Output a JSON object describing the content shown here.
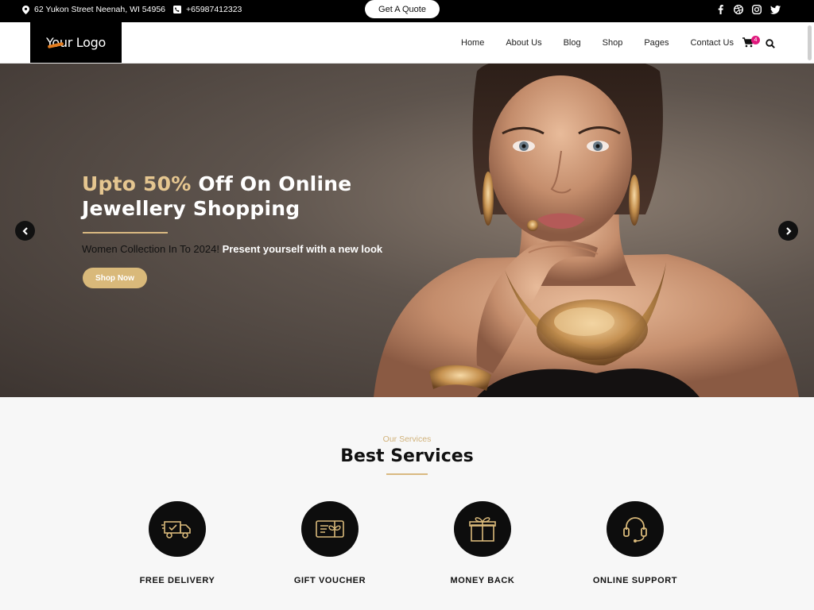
{
  "topbar": {
    "address": "62 Yukon Street Neenah, WI 54956",
    "phone": "+65987412323",
    "quote_label": "Get A Quote",
    "socials": [
      "facebook-icon",
      "dribbble-icon",
      "instagram-icon",
      "twitter-icon"
    ]
  },
  "nav": {
    "logo": "Your Logo",
    "menu": [
      "Home",
      "About Us",
      "Blog",
      "Shop",
      "Pages",
      "Contact Us"
    ],
    "cart_count": "4"
  },
  "hero": {
    "title_accent": "Upto 50%",
    "title_rest": " Off On Online",
    "title_line2": "Jewellery Shopping",
    "subtitle_dark": "Women Collection In To 2024!",
    "subtitle_light": " Present yourself with a new look",
    "cta": "Shop Now"
  },
  "services": {
    "kicker": "Our Services",
    "title": "Best Services",
    "items": [
      {
        "label": "FREE DELIVERY",
        "icon": "delivery-truck-icon"
      },
      {
        "label": "GIFT VOUCHER",
        "icon": "gift-voucher-icon"
      },
      {
        "label": "MONEY BACK",
        "icon": "gift-box-icon"
      },
      {
        "label": "ONLINE SUPPORT",
        "icon": "headset-icon"
      }
    ]
  },
  "colors": {
    "accent_gold": "#d9b97a",
    "badge_pink": "#e0197d",
    "topbar_bg": "#000000"
  }
}
